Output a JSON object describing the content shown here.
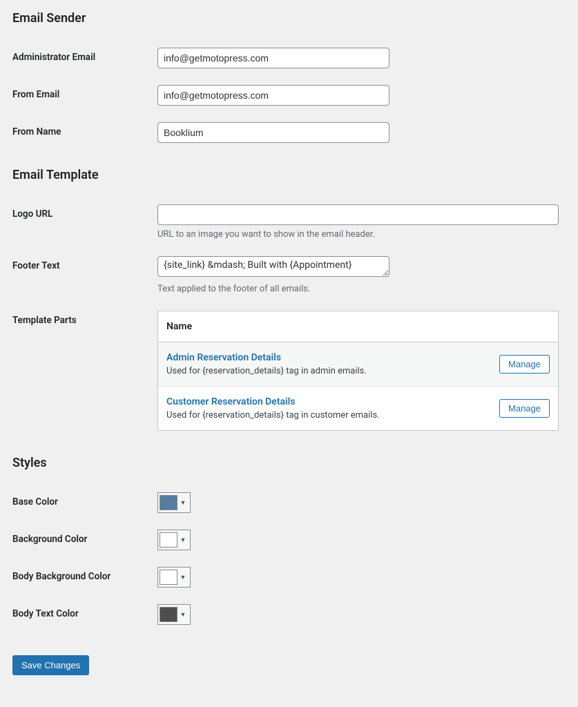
{
  "sections": {
    "emailSender": {
      "title": "Email Sender",
      "adminEmail": {
        "label": "Administrator Email",
        "value": "info@getmotopress.com"
      },
      "fromEmail": {
        "label": "From Email",
        "value": "info@getmotopress.com"
      },
      "fromName": {
        "label": "From Name",
        "value": "Booklium"
      }
    },
    "emailTemplate": {
      "title": "Email Template",
      "logoUrl": {
        "label": "Logo URL",
        "value": "",
        "description": "URL to an image you want to show in the email header."
      },
      "footerText": {
        "label": "Footer Text",
        "value": "{site_link} &mdash; Built with {Appointment}",
        "description": "Text applied to the footer of all emails."
      },
      "templateParts": {
        "label": "Template Parts",
        "header": "Name",
        "manageLabel": "Manage",
        "rows": [
          {
            "name": "Admin Reservation Details",
            "desc": "Used for {reservation_details} tag in admin emails."
          },
          {
            "name": "Customer Reservation Details",
            "desc": "Used for {reservation_details} tag in customer emails."
          }
        ]
      }
    },
    "styles": {
      "title": "Styles",
      "baseColor": {
        "label": "Base Color",
        "value": "#557da1"
      },
      "backgroundColor": {
        "label": "Background Color",
        "value": "#ffffff"
      },
      "bodyBackgroundColor": {
        "label": "Body Background Color",
        "value": "#ffffff"
      },
      "bodyTextColor": {
        "label": "Body Text Color",
        "value": "#4e4e4e"
      }
    }
  },
  "saveButton": "Save Changes"
}
